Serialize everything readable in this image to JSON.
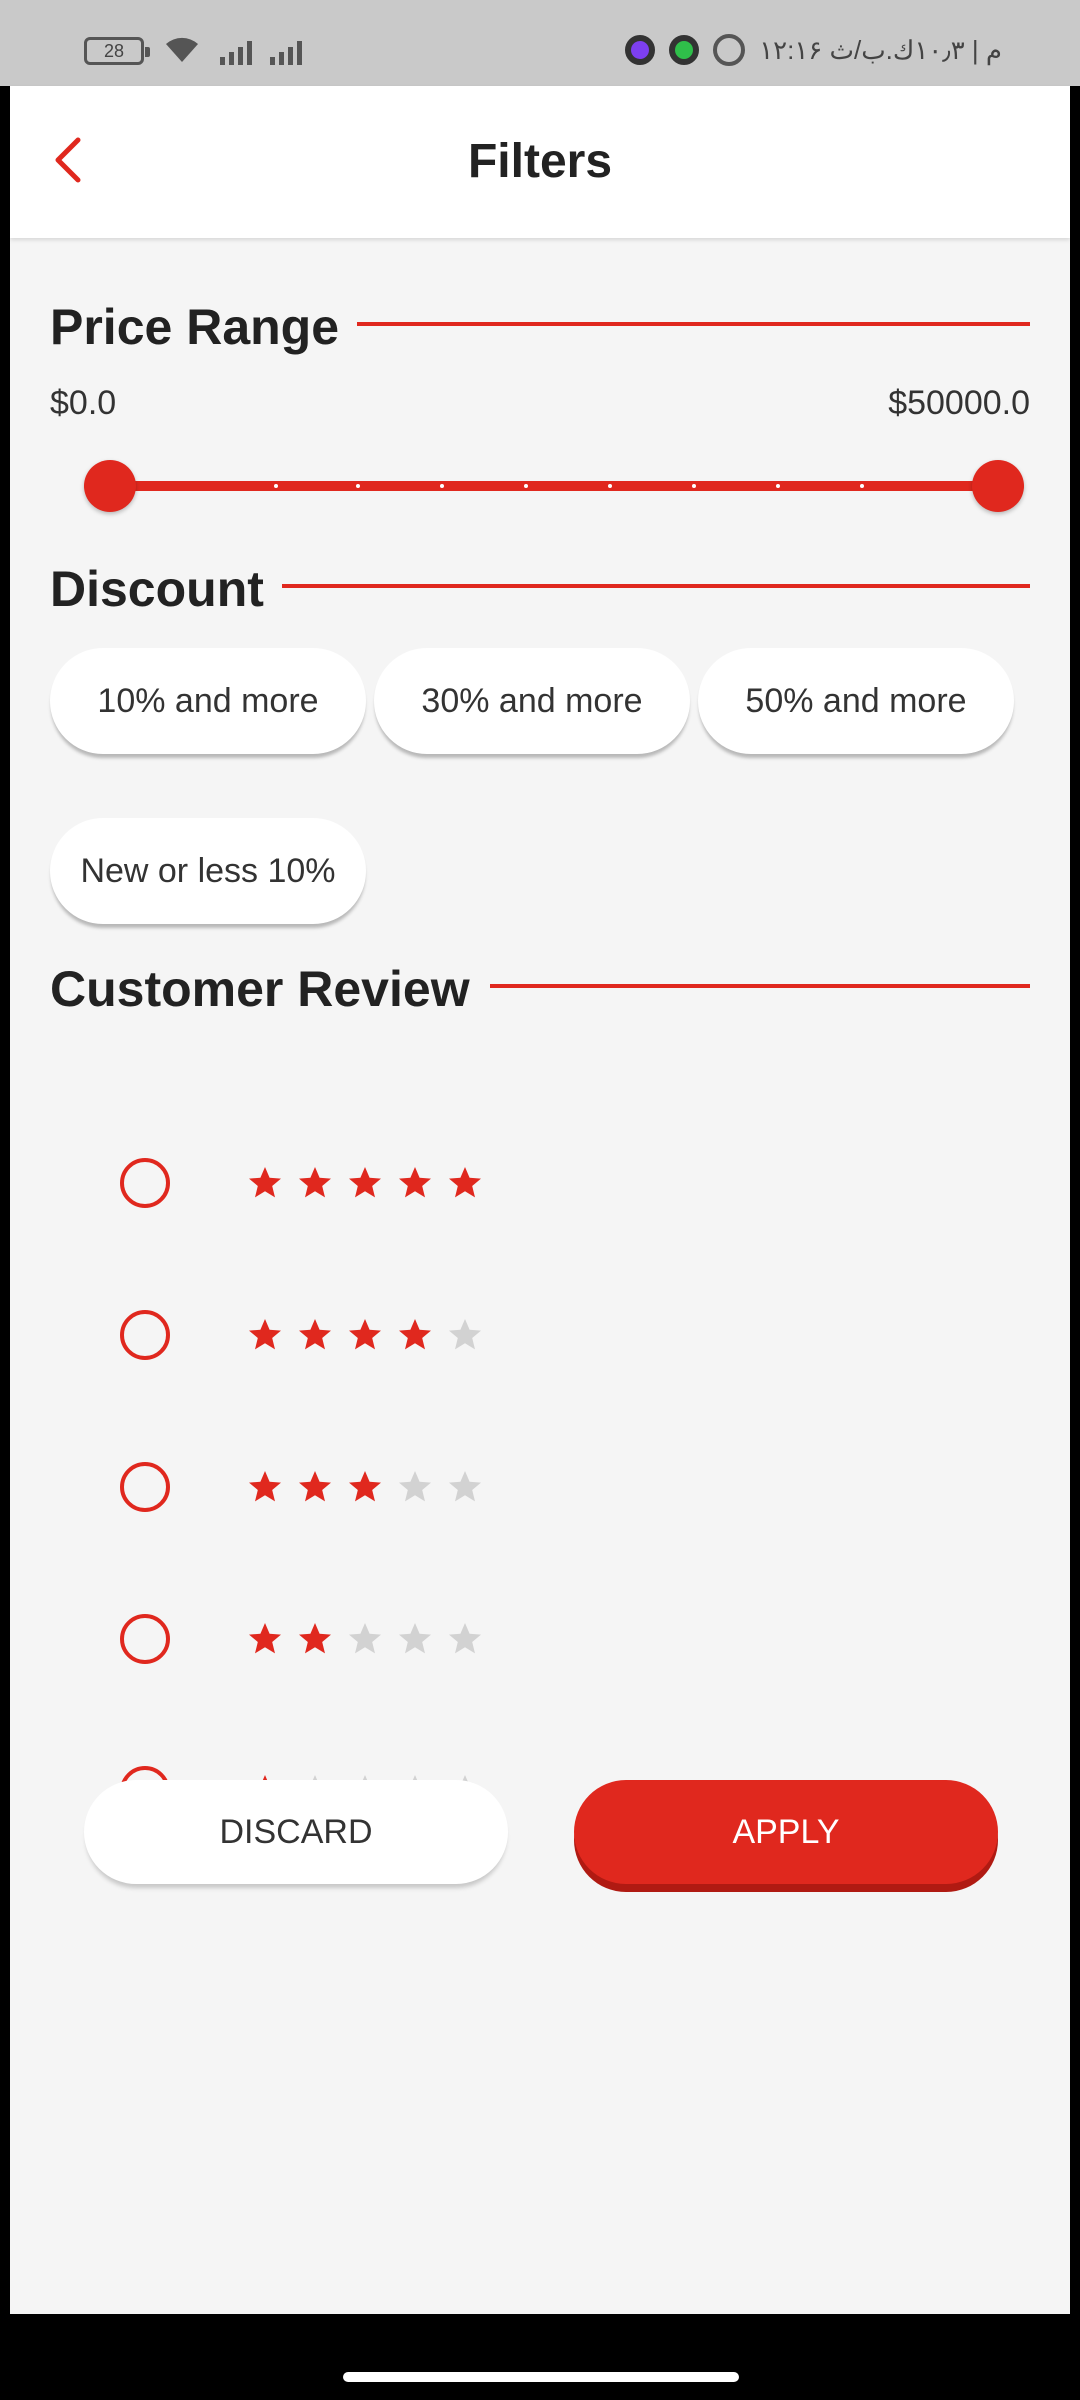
{
  "status_bar": {
    "battery": "28",
    "time_text": "۱۲:۱۶ م | ۱۰٫۳ك.ب/ث",
    "icons": [
      "battery-icon",
      "wifi-icon",
      "signal-icon",
      "app-icon-purple",
      "app-icon-green",
      "alarm-icon"
    ]
  },
  "header": {
    "title": "Filters",
    "back_icon": "chevron-left-icon"
  },
  "price_range": {
    "title": "Price Range",
    "min_label": "$0.0",
    "max_label": "$50000.0",
    "selected_min_fraction": 0.0,
    "selected_max_fraction": 1.0
  },
  "discount": {
    "title": "Discount",
    "options": [
      "10% and more",
      "30% and more",
      "50% and more",
      "New or less 10%"
    ]
  },
  "customer_review": {
    "title": "Customer Review",
    "options": [
      {
        "stars": 5,
        "selected": false
      },
      {
        "stars": 4,
        "selected": false
      },
      {
        "stars": 3,
        "selected": false
      },
      {
        "stars": 2,
        "selected": false
      },
      {
        "stars": 1,
        "selected": false
      }
    ]
  },
  "actions": {
    "discard": "DISCARD",
    "apply": "APPLY"
  },
  "colors": {
    "accent": "#e0281e",
    "background": "#f5f5f5",
    "star_inactive": "#d2d2d2"
  }
}
